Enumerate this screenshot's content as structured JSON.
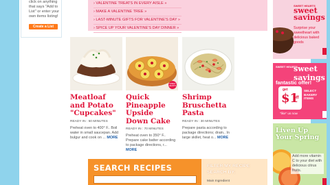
{
  "left": {
    "text": "click on anything that says \"Add to List\" or enter your own items listing!",
    "create_button": "Create a List"
  },
  "links": [
    "VALENTINE TREATS IN EVERY AISLE »",
    "MAKE A VALENTINE TREE »",
    "LAST-MINUTE GIFTS FOR VALENTINE'S DAY »",
    "SPICE UP YOUR VALENTINE'S DAY DINNER »"
  ],
  "recipes": [
    {
      "title": "Meatloaf and Potato \"Cupcakes\"",
      "ready": "READY IN : 50 MINUTES",
      "desc": "Preheat oven to 400° F.. Boil water in small saucepan. Add bulgur and cook on ...",
      "more": "MORE"
    },
    {
      "title": "Quick Pineapple Upside Down Cake",
      "ready": "READY IN : 70 MINUTES",
      "desc": "Preheat oven to 350° F.. Prepare cake batter according to package directions, r...",
      "more": "MORE"
    },
    {
      "title": "Shrimp Bruschetta Pasta",
      "ready": "READY IN : 30 MINUTES",
      "desc": "Prepare pasta according to package directions; drain.. In large skillet, heat o...",
      "more": "MORE"
    }
  ],
  "badge_text": "SWEET HEARTS",
  "search": {
    "title": "SEARCH RECIPES",
    "filter_title": "FILTER MY RECIPE SEARCH BY:",
    "filter_label": "Main Ingredient"
  },
  "ads": {
    "ad1": {
      "sub": "SWEET HEARTS",
      "big": "sweet savings",
      "text": "Surprise your sweetheart with delicious baked goods"
    },
    "ad2": {
      "sub": "SWEET HEARTS",
      "big": "sweet savings",
      "fantastic": "fantastic offer!",
      "get": "get",
      "one": "$1",
      "off": "off",
      "select": "SELECT BAKERY ITEMS",
      "like": "\"like\" us now"
    },
    "ad3": {
      "big": "Liven Up Your Spring",
      "text": "Add more vitamin C to your diet with delicious citrus fruits."
    }
  },
  "colors": {
    "background": "#8fd3ec",
    "accent_red": "#e0163b",
    "search_orange": "#f6922a",
    "links_pink": "#fbd1de"
  }
}
